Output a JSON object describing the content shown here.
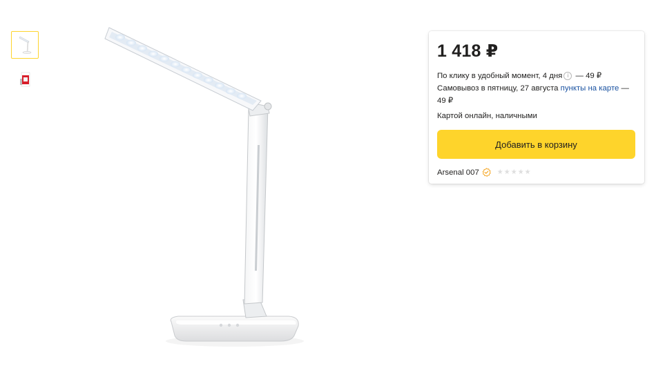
{
  "gallery": {
    "thumbnails": [
      {
        "icon": "lamp-thumbnail-icon",
        "active": true
      },
      {
        "icon": "lamp-box-thumbnail-icon",
        "active": false
      }
    ],
    "main_image_icon": "desk-lamp-image"
  },
  "offer": {
    "price": "1 418 ₽",
    "delivery": {
      "courier_text": "По клику в удобный момент, 4 дня",
      "courier_price": " — 49 ₽",
      "pickup_text": "Самовывоз в пятницу, 27 августа ",
      "pickup_link": "пункты на карте",
      "pickup_price": " — 49 ₽"
    },
    "payment": "Картой онлайн, наличными",
    "add_to_cart_label": "Добавить в корзину",
    "seller": {
      "name": "Arsenal 007",
      "rating_stars_filled": 0,
      "rating_stars_total": 5
    }
  },
  "colors": {
    "accent_yellow": "#fed42b",
    "link_blue": "#1a52a1",
    "verified_orange": "#f5a623",
    "star_empty": "#dedede"
  }
}
